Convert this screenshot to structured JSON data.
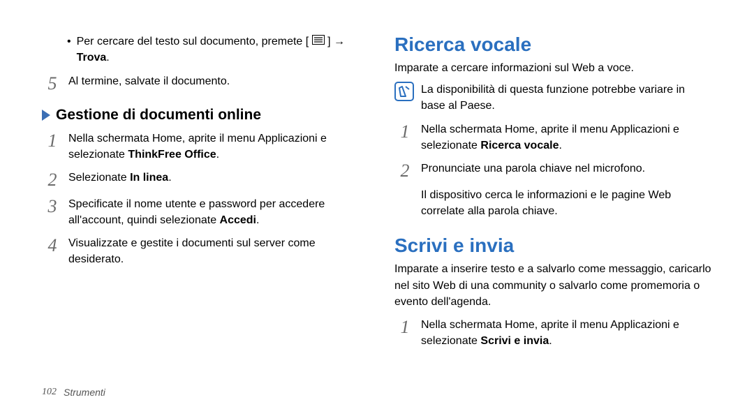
{
  "left": {
    "bullet": {
      "pre": "Per cercare del testo sul documento, premete [",
      "post": "] →",
      "bold": "Trova",
      "end": "."
    },
    "step5_num": "5",
    "step5": "Al termine, salvate il documento.",
    "subhead": "Gestione di documenti online",
    "s1_num": "1",
    "s1_pre": "Nella schermata Home, aprite il menu Applicazioni e selezionate ",
    "s1_bold": "ThinkFree Office",
    "s1_end": ".",
    "s2_num": "2",
    "s2_pre": "Selezionate ",
    "s2_bold": "In linea",
    "s2_end": ".",
    "s3_num": "3",
    "s3_pre": "Specificate il nome utente e password per accedere all'account, quindi selezionate ",
    "s3_bold": "Accedi",
    "s3_end": ".",
    "s4_num": "4",
    "s4": "Visualizzate e gestite i documenti sul server come desiderato."
  },
  "right": {
    "h1a": "Ricerca vocale",
    "intro_a": "Imparate a cercare informazioni sul Web a voce.",
    "note": "La disponibilità di questa funzione potrebbe variare in base al Paese.",
    "a1_num": "1",
    "a1_pre": "Nella schermata Home, aprite il menu Applicazioni e selezionate ",
    "a1_bold": "Ricerca vocale",
    "a1_end": ".",
    "a2_num": "2",
    "a2": "Pronunciate una parola chiave nel microfono.",
    "a2_sub": "Il dispositivo cerca le informazioni e le pagine Web correlate alla parola chiave.",
    "h1b": "Scrivi e invia",
    "intro_b": "Imparate a inserire testo e a salvarlo come messaggio, caricarlo nel sito Web di una community o salvarlo come promemoria o evento dell'agenda.",
    "b1_num": "1",
    "b1_pre": "Nella schermata Home, aprite il menu Applicazioni e selezionate ",
    "b1_bold": "Scrivi e invia",
    "b1_end": "."
  },
  "footer": {
    "page": "102",
    "label": "Strumenti"
  }
}
